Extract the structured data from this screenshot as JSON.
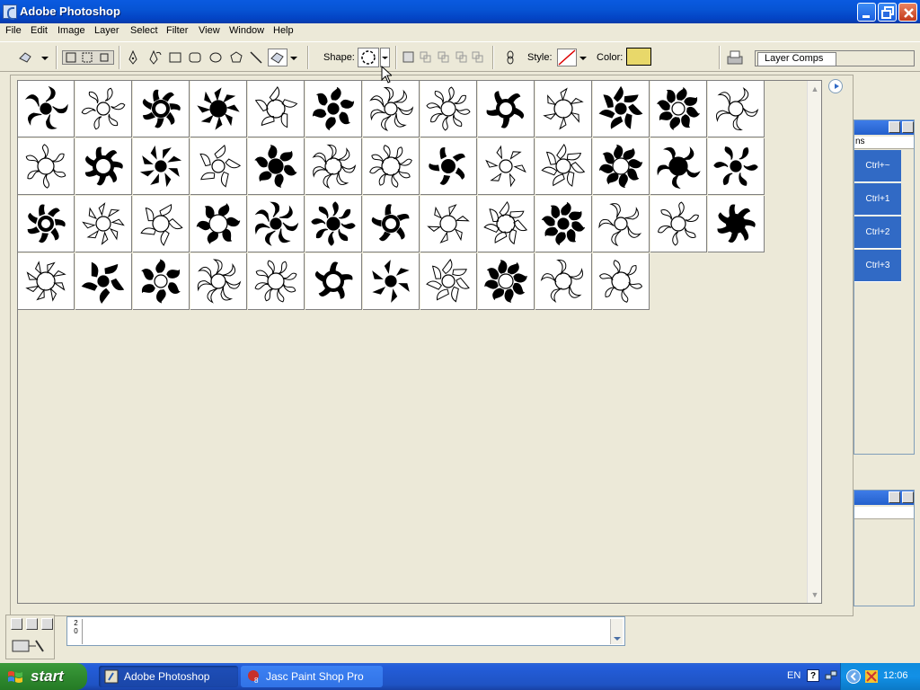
{
  "window": {
    "title": "Adobe Photoshop"
  },
  "menu": [
    "File",
    "Edit",
    "Image",
    "Layer",
    "Select",
    "Filter",
    "View",
    "Window",
    "Help"
  ],
  "options_bar": {
    "shape_label": "Shape:",
    "style_label": "Style:",
    "color_label": "Color:",
    "color_value": "#e8d86a",
    "layer_comps_tab": "Layer Comps"
  },
  "actions_panel": {
    "rows": [
      "Ctrl+~",
      "Ctrl+1",
      "Ctrl+2",
      "Ctrl+3"
    ]
  },
  "shape_picker": {
    "shape_count": 50,
    "columns": 13
  },
  "ruler_marks": [
    "2",
    "0"
  ],
  "taskbar": {
    "start_label": "start",
    "tasks": [
      "Adobe Photoshop",
      "Jasc Paint Shop Pro"
    ],
    "language": "EN",
    "clock": "12:06"
  }
}
